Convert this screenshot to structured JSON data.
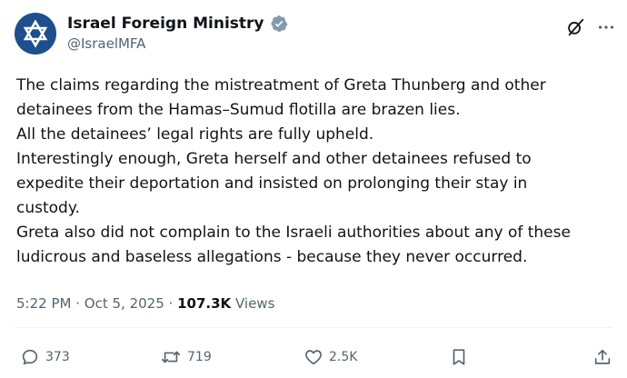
{
  "account": {
    "display_name": "Israel Foreign Ministry",
    "handle": "@IsraelMFA"
  },
  "tweet": {
    "text": "The claims regarding the mistreatment of Greta Thunberg and other\ndetainees from the Hamas–Sumud flotilla are brazen lies.\nAll the detainees’ legal rights are fully upheld.\nInterestingly enough, Greta herself and other detainees refused to\nexpedite their deportation and insisted on prolonging their stay in\ncustody.\nGreta also did not complain to the Israeli authorities about any of these\nludicrous and baseless allegations - because they never occurred.",
    "time": "5:22 PM",
    "separator": "·",
    "date": "Oct 5, 2025",
    "views_count": "107.3K",
    "views_label": "Views"
  },
  "actions": {
    "replies": "373",
    "reposts": "719",
    "likes": "2.5K"
  },
  "colors": {
    "text_primary": "#0f1419",
    "text_secondary": "#536471",
    "verified_badge": "#829aab",
    "avatar_bg": "#1d4f8c"
  },
  "icons": {
    "avatar": "israel-mfa-logo-icon",
    "verified": "verified-badge-icon",
    "grok": "grok-icon",
    "more": "more-icon",
    "reply": "reply-icon",
    "repost": "repost-icon",
    "like": "heart-icon",
    "bookmark": "bookmark-icon",
    "share": "share-icon"
  }
}
